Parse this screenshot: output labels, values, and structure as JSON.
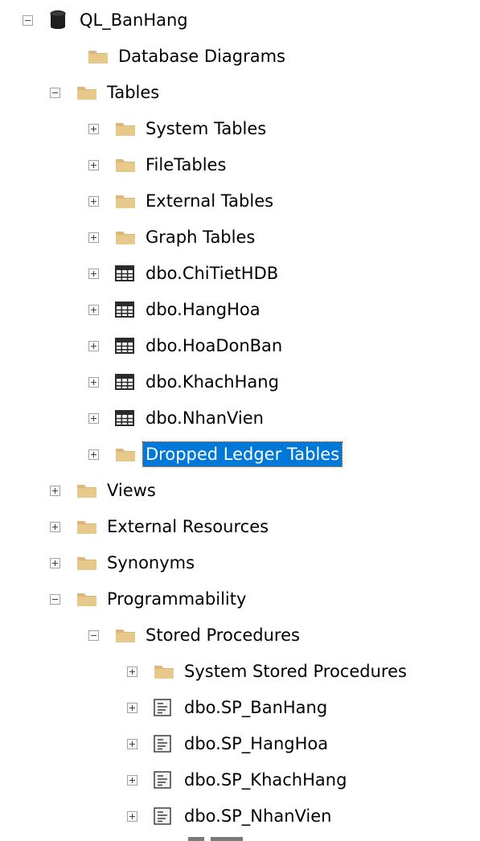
{
  "tree": {
    "nodes": [
      {
        "id": "ql-banhang",
        "label": "QL_BanHang",
        "icon": "database-icon",
        "expander": "expanded"
      },
      {
        "id": "database-diagrams",
        "label": "Database Diagrams",
        "icon": "folder-icon",
        "expander": "none"
      },
      {
        "id": "tables",
        "label": "Tables",
        "icon": "folder-icon",
        "expander": "expanded"
      },
      {
        "id": "system-tables",
        "label": "System Tables",
        "icon": "folder-icon",
        "expander": "collapsed"
      },
      {
        "id": "filetables",
        "label": "FileTables",
        "icon": "folder-icon",
        "expander": "collapsed"
      },
      {
        "id": "external-tables",
        "label": "External Tables",
        "icon": "folder-icon",
        "expander": "collapsed"
      },
      {
        "id": "graph-tables",
        "label": "Graph Tables",
        "icon": "folder-icon",
        "expander": "collapsed"
      },
      {
        "id": "dbo-chitiethdb",
        "label": "dbo.ChiTietHDB",
        "icon": "table-icon",
        "expander": "collapsed"
      },
      {
        "id": "dbo-hanghoa",
        "label": "dbo.HangHoa",
        "icon": "table-icon",
        "expander": "collapsed"
      },
      {
        "id": "dbo-hoadonban",
        "label": "dbo.HoaDonBan",
        "icon": "table-icon",
        "expander": "collapsed"
      },
      {
        "id": "dbo-khachhang",
        "label": "dbo.KhachHang",
        "icon": "table-icon",
        "expander": "collapsed"
      },
      {
        "id": "dbo-nhanvien",
        "label": "dbo.NhanVien",
        "icon": "table-icon",
        "expander": "collapsed"
      },
      {
        "id": "dropped-ledger-tables",
        "label": "Dropped Ledger Tables",
        "icon": "folder-icon",
        "expander": "collapsed",
        "selected": true
      },
      {
        "id": "views",
        "label": "Views",
        "icon": "folder-icon",
        "expander": "collapsed"
      },
      {
        "id": "external-resources",
        "label": "External Resources",
        "icon": "folder-icon",
        "expander": "collapsed"
      },
      {
        "id": "synonyms",
        "label": "Synonyms",
        "icon": "folder-icon",
        "expander": "collapsed"
      },
      {
        "id": "programmability",
        "label": "Programmability",
        "icon": "folder-icon",
        "expander": "expanded"
      },
      {
        "id": "stored-procedures",
        "label": "Stored Procedures",
        "icon": "folder-icon",
        "expander": "expanded"
      },
      {
        "id": "system-stored-procedures",
        "label": "System Stored Procedures",
        "icon": "folder-icon",
        "expander": "collapsed"
      },
      {
        "id": "dbo-sp-banhang",
        "label": "dbo.SP_BanHang",
        "icon": "stored-procedure-icon",
        "expander": "collapsed"
      },
      {
        "id": "dbo-sp-hanghoa",
        "label": "dbo.SP_HangHoa",
        "icon": "stored-procedure-icon",
        "expander": "collapsed"
      },
      {
        "id": "dbo-sp-khachhang",
        "label": "dbo.SP_KhachHang",
        "icon": "stored-procedure-icon",
        "expander": "collapsed"
      },
      {
        "id": "dbo-sp-nhanvien",
        "label": "dbo.SP_NhanVien",
        "icon": "stored-procedure-icon",
        "expander": "collapsed"
      }
    ]
  },
  "colors": {
    "folder": "#dcb67a",
    "folder_light": "#e8c98c",
    "selection": "#0078d7",
    "expander_border": "#a0a0a0"
  }
}
